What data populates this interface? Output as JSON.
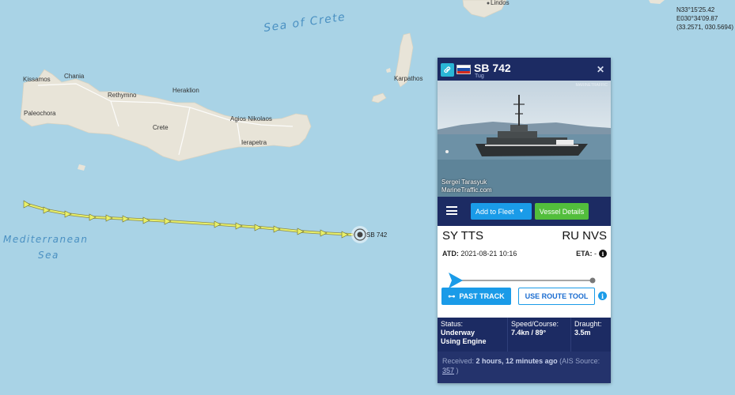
{
  "map": {
    "sea_labels": [
      "Sea of Crete",
      "Mediterranean",
      "Sea"
    ],
    "places": [
      "Lindos",
      "Kissamos",
      "Chania",
      "Rethymno",
      "Heraklion",
      "Paleochora",
      "Crete",
      "Agios Nikolaos",
      "Ierapetra",
      "Karpathos"
    ],
    "vessel_marker_label": "SB 742",
    "coordinates": {
      "lat": "N33°15'25.42",
      "lon": "E030°34'09.87",
      "decimal": "(33.2571, 030.5694)"
    },
    "colors": {
      "sea": "#a9d3e6",
      "land": "#e8e4d8",
      "track": "#e8f06a"
    }
  },
  "panel": {
    "icon": "link-icon",
    "flag": "russia-flag",
    "vessel_name": "SB 742",
    "vessel_type": "Tug",
    "photo_credit_line1": "Sergei Tarasyuk",
    "photo_credit_line2": "MarineTraffic.com",
    "photo_logo": "MARINETRAFFIC",
    "add_to_fleet": "Add to Fleet",
    "vessel_details": "Vessel Details",
    "departure": "SY TTS",
    "arrival": "RU NVS",
    "atd_label": "ATD:",
    "atd_value": "2021-08-21 10:16",
    "eta_label": "ETA:",
    "eta_value": "-",
    "past_track": "PAST TRACK",
    "route_tool": "USE ROUTE TOOL",
    "status": [
      {
        "label": "Status:",
        "value_line1": "Underway",
        "value_line2": "Using Engine"
      },
      {
        "label": "Speed/Course:",
        "value_line1": "7.4kn / 89°",
        "value_line2": ""
      },
      {
        "label": "Draught:",
        "value_line1": "3.5m",
        "value_line2": ""
      }
    ],
    "received_label": "Received:",
    "received_value": "2 hours, 12 minutes ago",
    "ais_label": "(AIS",
    "source_label": "Source:",
    "source_value": "357",
    "source_close": ")"
  }
}
